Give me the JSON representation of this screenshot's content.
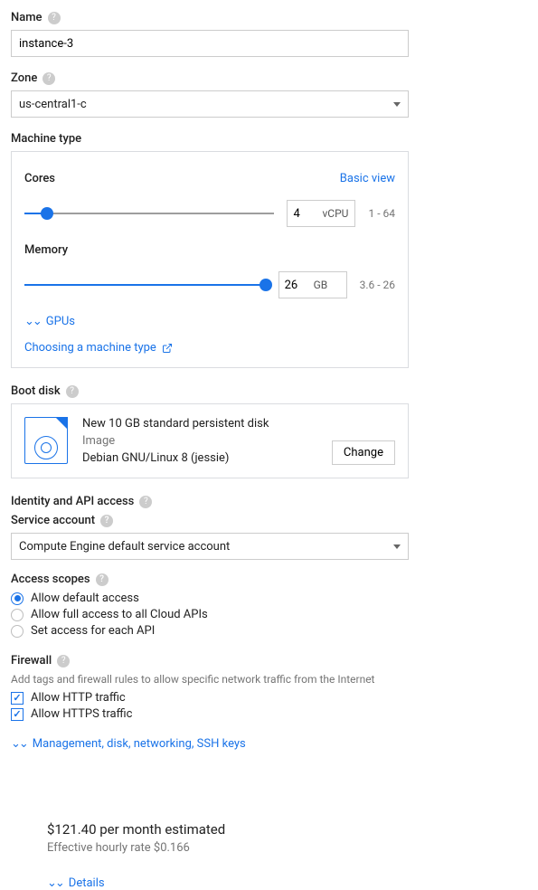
{
  "name": {
    "label": "Name",
    "value": "instance-3"
  },
  "zone": {
    "label": "Zone",
    "value": "us-central1-c"
  },
  "machine_type": {
    "label": "Machine type",
    "basic_view": "Basic view",
    "cores": {
      "label": "Cores",
      "value": "4",
      "unit": "vCPU",
      "range": "1 - 64",
      "percent": 9
    },
    "memory": {
      "label": "Memory",
      "value": "26",
      "unit": "GB",
      "range": "3.6 - 26",
      "percent": 100
    },
    "gpus": "GPUs",
    "choosing_link": "Choosing a machine type"
  },
  "boot_disk": {
    "label": "Boot disk",
    "title": "New 10 GB standard persistent disk",
    "image_label": "Image",
    "image_value": "Debian GNU/Linux 8 (jessie)",
    "change": "Change"
  },
  "identity": {
    "label": "Identity and API access",
    "service_account_label": "Service account",
    "service_account_value": "Compute Engine default service account",
    "scopes_label": "Access scopes",
    "scopes": {
      "default": "Allow default access",
      "full": "Allow full access to all Cloud APIs",
      "each": "Set access for each API"
    }
  },
  "firewall": {
    "label": "Firewall",
    "hint": "Add tags and firewall rules to allow specific network traffic from the Internet",
    "http": "Allow HTTP traffic",
    "https": "Allow HTTPS traffic"
  },
  "expand_link": "Management, disk, networking, SSH keys",
  "pricing": {
    "monthly": "$121.40 per month estimated",
    "hourly": "Effective hourly rate $0.166",
    "details": "Details"
  }
}
